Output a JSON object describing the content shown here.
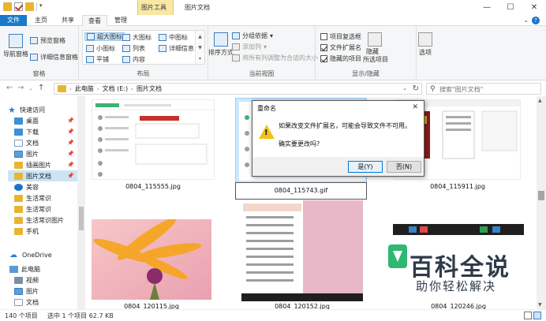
{
  "window": {
    "context_tab_group": "图片工具",
    "title": "图片文档"
  },
  "tabs": [
    {
      "label": "文件"
    },
    {
      "label": "主页"
    },
    {
      "label": "共享"
    },
    {
      "label": "查看"
    },
    {
      "label": "管理"
    }
  ],
  "ribbon": {
    "panes": {
      "label": "窗格",
      "nav_pane": "导航窗格",
      "preview_pane": "预览窗格",
      "details_pane": "详细信息窗格"
    },
    "layout": {
      "label": "布局",
      "extra_large": "超大图标",
      "large": "大图标",
      "medium": "中图标",
      "small": "小图标",
      "list": "列表",
      "details": "详细信息",
      "tiles": "平铺",
      "content": "内容"
    },
    "current_view": {
      "label": "当前视图",
      "sort_by": "排序方式",
      "group_by": "分组依据",
      "add_columns": "添加列",
      "size_columns": "将所有列调整为合适的大小"
    },
    "show_hide": {
      "label": "显示/隐藏",
      "item_checkboxes": "项目复选框",
      "file_extensions": "文件扩展名",
      "hidden_items": "隐藏的项目",
      "hide_selected": "隐藏",
      "hide_selected_line2": "所选项目",
      "options": "选项"
    }
  },
  "address": {
    "segments": [
      "此电脑",
      "文档 (E:)",
      "图片文档"
    ],
    "search_placeholder": "搜索\"图片文档\""
  },
  "nav": {
    "items": [
      {
        "label": "快速访问"
      },
      {
        "label": "桌面"
      },
      {
        "label": "下载"
      },
      {
        "label": "文档"
      },
      {
        "label": "图片"
      },
      {
        "label": "插画图片"
      },
      {
        "label": "图片文档"
      },
      {
        "label": "美容"
      },
      {
        "label": "生活常识"
      },
      {
        "label": "生活常识"
      },
      {
        "label": "生活常识图片"
      },
      {
        "label": "手机"
      },
      {
        "label": "OneDrive"
      },
      {
        "label": "此电脑"
      },
      {
        "label": "视频"
      },
      {
        "label": "图片"
      },
      {
        "label": "文档"
      }
    ]
  },
  "files": [
    {
      "name": "0804_115555.jpg"
    },
    {
      "name": "0804_115743.gif"
    },
    {
      "name": "0804_115911.jpg"
    },
    {
      "name": "0804_120115.jpg"
    },
    {
      "name": "0804_120152.jpg"
    },
    {
      "name": "0804_120246.jpg"
    }
  ],
  "dialog": {
    "title": "重命名",
    "message_line1": "如果改变文件扩展名，可能会导致文件不可用。",
    "message_line2": "确实要更改吗?",
    "yes": "是(Y)",
    "no": "否(N)"
  },
  "status": {
    "count": "140 个项目",
    "selection": "选中 1 个项目  62.7 KB"
  },
  "watermark": {
    "title": "百科全说",
    "subtitle": "助你轻松解决"
  },
  "colors": {
    "accent": "#1979ca",
    "selection": "#cce8ff",
    "context_tab": "#f8e8a5"
  }
}
